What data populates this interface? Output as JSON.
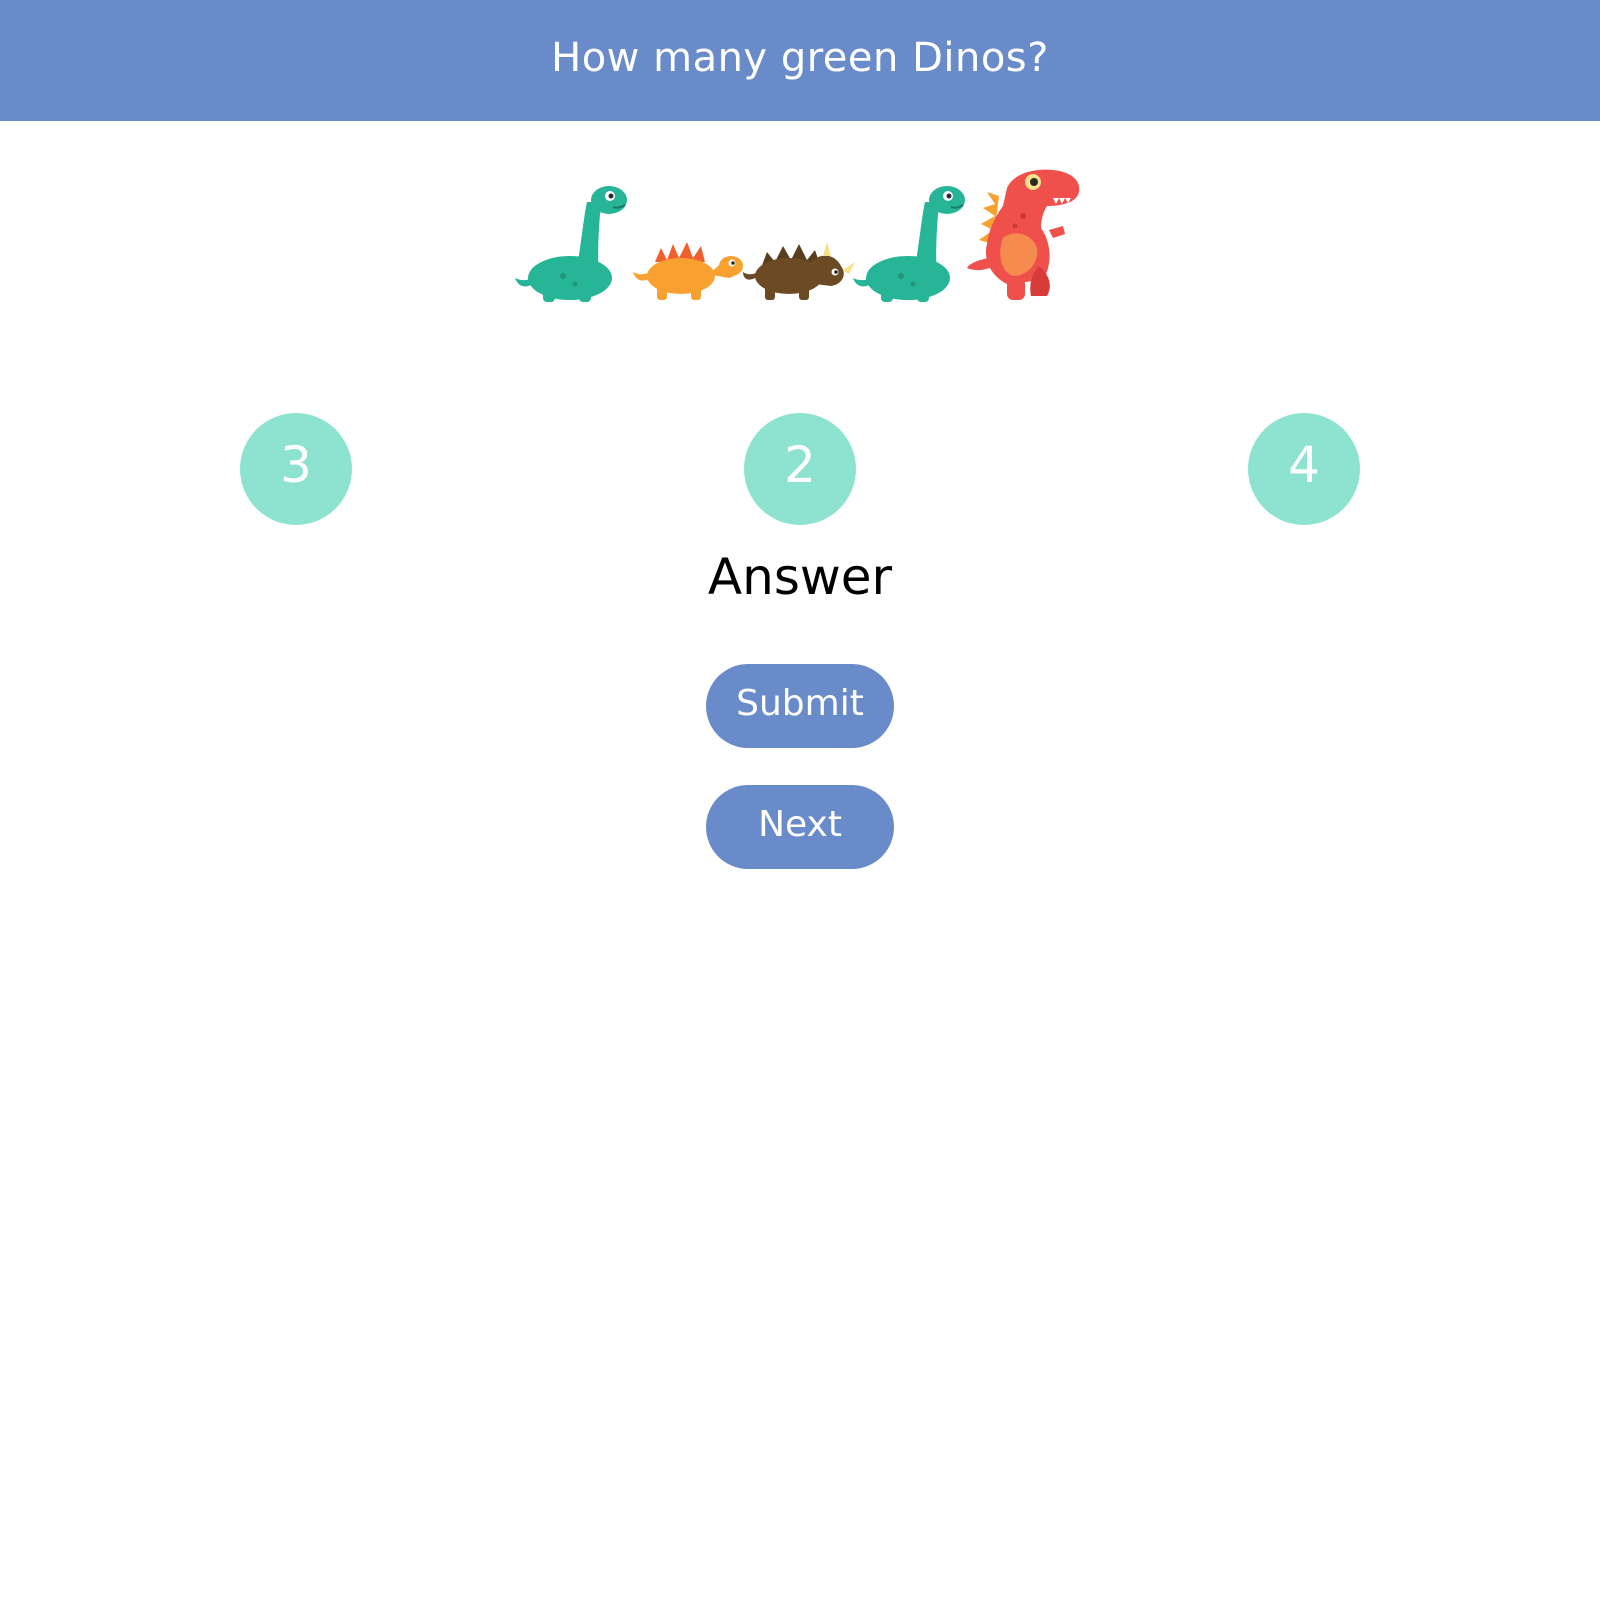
{
  "header": {
    "title": "How many green Dinos?"
  },
  "dinos": [
    {
      "kind": "long-neck",
      "color": "#26b597"
    },
    {
      "kind": "stegosaurus",
      "color": "#f9a130"
    },
    {
      "kind": "triceratops",
      "color": "#6b4a24"
    },
    {
      "kind": "long-neck",
      "color": "#26b597"
    },
    {
      "kind": "t-rex",
      "color": "#f0504b"
    }
  ],
  "choices": [
    {
      "label": "3"
    },
    {
      "label": "2"
    },
    {
      "label": "4"
    }
  ],
  "answer": {
    "label": "Answer"
  },
  "buttons": {
    "submit_label": "Submit",
    "next_label": "Next"
  },
  "colors": {
    "header_bg": "#6a8bca",
    "choice_bg": "#8ee3d0",
    "button_bg": "#6a8bca"
  }
}
